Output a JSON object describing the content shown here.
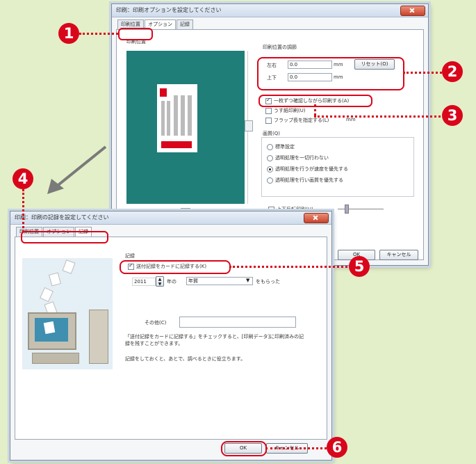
{
  "colors": {
    "accent": "#d9061b",
    "preview_bg": "#1f7e78",
    "background": "#e3efc8"
  },
  "back_window": {
    "title": "印刷：印刷オプションを設定してください",
    "tabs": [
      "印刷位置",
      "オプション",
      "記録"
    ],
    "preview_label": "印刷位置",
    "offset_group_label": "印刷位置の調節",
    "horizontal_label": "左右",
    "horizontal_value": "0.0",
    "vertical_label": "上下",
    "vertical_value": "0.0",
    "unit": "mm",
    "reset_button": "リセット(O)",
    "check_one_sheet": "一枚ずつ確認しながら印刷する(A)",
    "check_thin_paper": "うす紙印刷(U)",
    "check_flap": "フラップ長を指定する(L)",
    "flap_unit": "mm",
    "quality_label": "画質(Q)",
    "quality_options": [
      "標準設定",
      "透明処理を一切行わない",
      "透明処理を行うが速度を優先する",
      "透明処理を行い画質を優先する"
    ],
    "check_upside_down": "上下反転印刷(H)",
    "ok_button": "OK",
    "cancel_button": "キャンセル"
  },
  "front_window": {
    "title": "印刷：印刷の記録を設定してください",
    "tabs": [
      "印刷位置",
      "オプション",
      "記録"
    ],
    "record_group_label": "記録",
    "record_checkbox": "送付記録をカードに記録する(K)",
    "year_value": "2011",
    "year_suffix": "年の",
    "period_value": "年賀",
    "period_suffix": "をもらった",
    "memo_label": "その他(C)",
    "memo_value": "",
    "help_text_1": "「送付記録をカードに記録する」をチェックすると、[印刷データ]に印刷済みの記録を残すことができます。",
    "help_text_2": "記録をしておくと、あとで、調べるときに役立ちます。",
    "ok_button": "OK",
    "cancel_button": "キャンセル"
  },
  "callouts": [
    "1",
    "2",
    "3",
    "4",
    "5",
    "6"
  ]
}
